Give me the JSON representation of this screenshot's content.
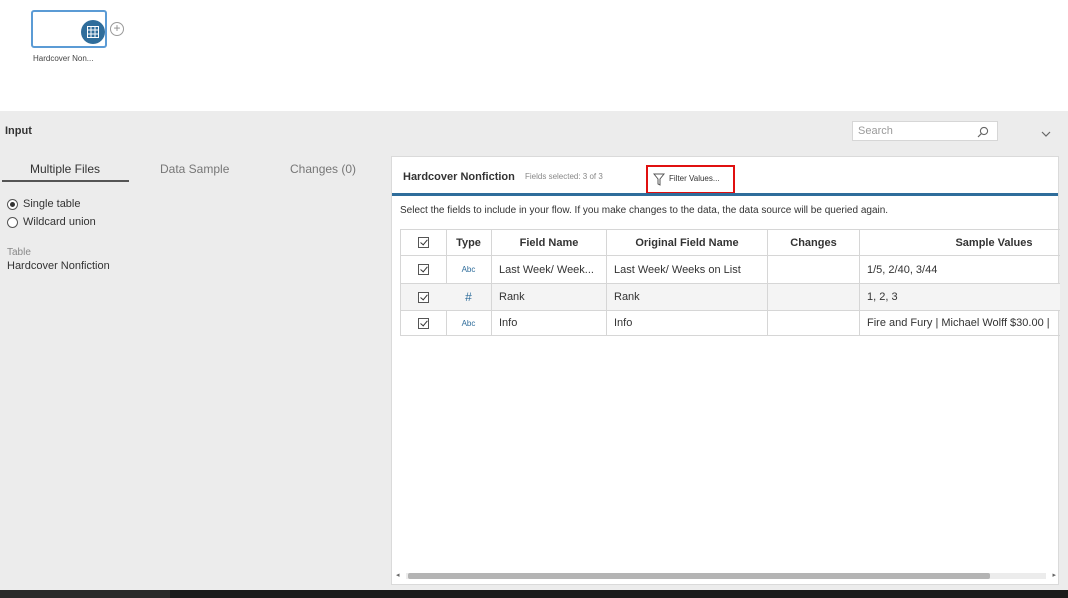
{
  "flow": {
    "node_label": "Hardcover Non..."
  },
  "panel": {
    "title": "Input",
    "search_placeholder": "Search"
  },
  "tabs": [
    {
      "label": "Multiple Files"
    },
    {
      "label": "Data Sample"
    },
    {
      "label": "Changes (0)"
    }
  ],
  "options": {
    "single_table": "Single table",
    "wildcard_union": "Wildcard union",
    "selected": "Single table"
  },
  "table_info": {
    "caption": "Table",
    "value": "Hardcover Nonfiction"
  },
  "content": {
    "title": "Hardcover Nonfiction",
    "fields_selected": "Fields selected: 3 of 3",
    "filter_label": "Filter Values...",
    "instructions": "Select the fields to include in your flow. If you make changes to the data, the data source will be queried again."
  },
  "grid": {
    "headers": [
      "Type",
      "Field Name",
      "Original Field Name",
      "Changes",
      "Sample Values"
    ],
    "rows": [
      {
        "checked": true,
        "type": "Abc",
        "field": "Last Week/ Week...",
        "original": "Last Week/ Weeks on List",
        "changes": "",
        "sample": "1/5, 2/40, 3/44"
      },
      {
        "checked": true,
        "type": "#",
        "field": "Rank",
        "original": "Rank",
        "changes": "",
        "sample": "1, 2, 3"
      },
      {
        "checked": true,
        "type": "Abc",
        "field": "Info",
        "original": "Info",
        "changes": "",
        "sample": "Fire and Fury | Michael Wolff $30.00 |"
      }
    ]
  },
  "colors": {
    "accent": "#2f6d9b",
    "highlight": "#e01010",
    "panel_bg": "#ececec"
  }
}
